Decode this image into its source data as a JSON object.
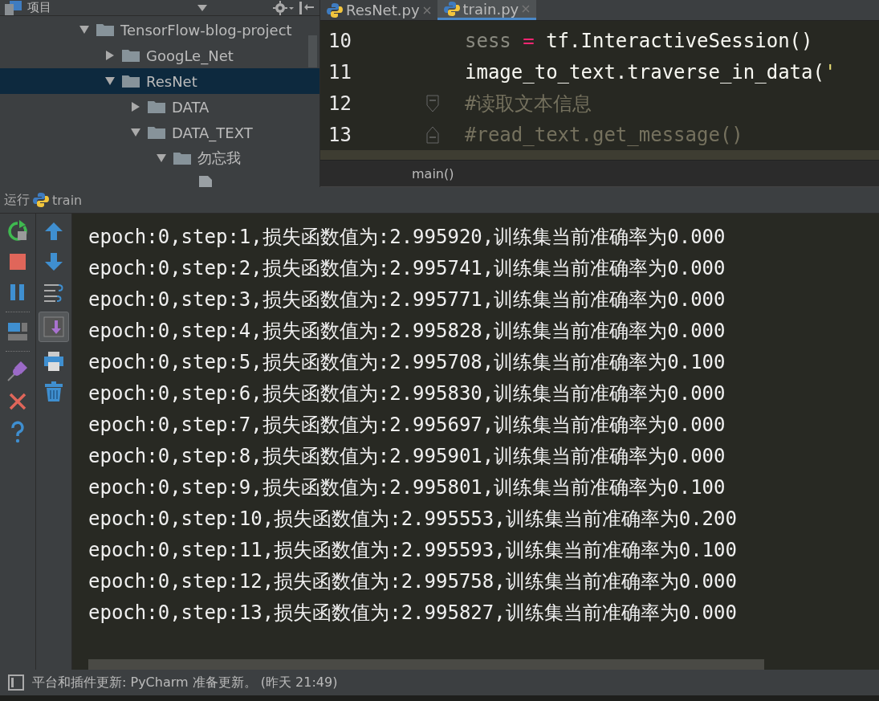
{
  "project_panel": {
    "title": "项目",
    "tree": [
      {
        "label": "TensorFlow-blog-project",
        "kind": "folder",
        "expanded": true,
        "selected": false,
        "children": [
          {
            "label": "GoogLe_Net",
            "kind": "folder",
            "expanded": false,
            "selected": false
          },
          {
            "label": "ResNet",
            "kind": "folder",
            "expanded": true,
            "selected": true,
            "children": [
              {
                "label": "DATA",
                "kind": "folder",
                "expanded": false,
                "selected": false
              },
              {
                "label": "DATA_TEXT",
                "kind": "folder",
                "expanded": true,
                "selected": false,
                "children": [
                  {
                    "label": "勿忘我",
                    "kind": "folder",
                    "expanded": true,
                    "selected": false,
                    "children": [
                      {
                        "kind": "file"
                      }
                    ]
                  }
                ]
              }
            ]
          }
        ]
      }
    ]
  },
  "editor": {
    "tabs": [
      {
        "label": "ResNet.py",
        "selected": false
      },
      {
        "label": "train.py",
        "selected": true
      }
    ],
    "lines": [
      {
        "number": "10",
        "kind": "code",
        "tokens": [
          {
            "kind": "unused",
            "text": "sess"
          },
          {
            "kind": "operator",
            "text": " = "
          },
          {
            "kind": "plain",
            "text": "tf.InteractiveSession()"
          }
        ]
      },
      {
        "number": "11",
        "kind": "code",
        "tokens": [
          {
            "kind": "plain",
            "text": "image_to_text.traverse_in_data("
          },
          {
            "kind": "string",
            "text": "'"
          }
        ]
      },
      {
        "number": "12",
        "kind": "fold_start",
        "tokens": [
          {
            "kind": "comment",
            "text": "#读取文本信息"
          }
        ]
      },
      {
        "number": "13",
        "kind": "fold_end",
        "tokens": [
          {
            "kind": "comment",
            "text": "#read_text.get_message()"
          }
        ]
      }
    ],
    "breadcrumb": "main()"
  },
  "run_panel": {
    "label": "运行",
    "config": "train",
    "auto_scroll": true,
    "output": [
      "epoch:0,step:1,损失函数值为:2.995920,训练集当前准确率为0.000",
      "epoch:0,step:2,损失函数值为:2.995741,训练集当前准确率为0.000",
      "epoch:0,step:3,损失函数值为:2.995771,训练集当前准确率为0.000",
      "epoch:0,step:4,损失函数值为:2.995828,训练集当前准确率为0.000",
      "epoch:0,step:5,损失函数值为:2.995708,训练集当前准确率为0.100",
      "epoch:0,step:6,损失函数值为:2.995830,训练集当前准确率为0.000",
      "epoch:0,step:7,损失函数值为:2.995697,训练集当前准确率为0.000",
      "epoch:0,step:8,损失函数值为:2.995901,训练集当前准确率为0.000",
      "epoch:0,step:9,损失函数值为:2.995801,训练集当前准确率为0.100",
      "epoch:0,step:10,损失函数值为:2.995553,训练集当前准确率为0.200",
      "epoch:0,step:11,损失函数值为:2.995593,训练集当前准确率为0.100",
      "epoch:0,step:12,损失函数值为:2.995758,训练集当前准确率为0.000",
      "epoch:0,step:13,损失函数值为:2.995827,训练集当前准确率为0.000"
    ]
  },
  "status_bar": {
    "message": "平台和插件更新: PyCharm 准备更新。 (昨天 21:49)"
  }
}
